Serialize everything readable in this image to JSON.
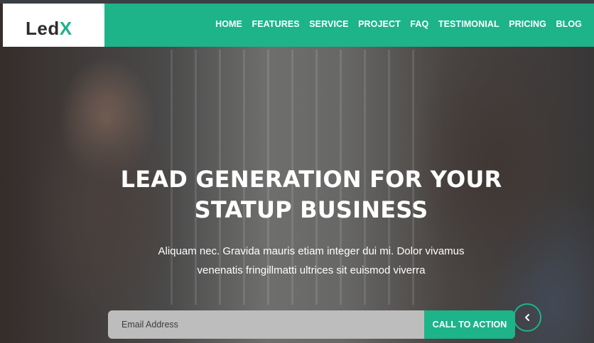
{
  "brand": {
    "logo_main": "Led",
    "logo_accent": "X"
  },
  "nav": {
    "items": [
      "HOME",
      "FEATURES",
      "SERVICE",
      "PROJECT",
      "FAQ",
      "TESTIMONIAL",
      "PRICING",
      "BLOG"
    ]
  },
  "hero": {
    "headline_line1": "LEAD GENERATION FOR YOUR",
    "headline_line2": "STATUP BUSINESS",
    "subtext_line1": "Aliquam nec. Gravida mauris etiam integer dui mi. Dolor vivamus",
    "subtext_line2": "venenatis fringillmatti ultrices sit euismod viverra"
  },
  "form": {
    "email_placeholder": "Email Address",
    "cta_label": "CALL TO ACTION"
  },
  "carousel": {
    "prev_icon": "chevron-left-icon"
  },
  "colors": {
    "accent": "#1db48a",
    "logo_text": "#2c2c2c"
  }
}
